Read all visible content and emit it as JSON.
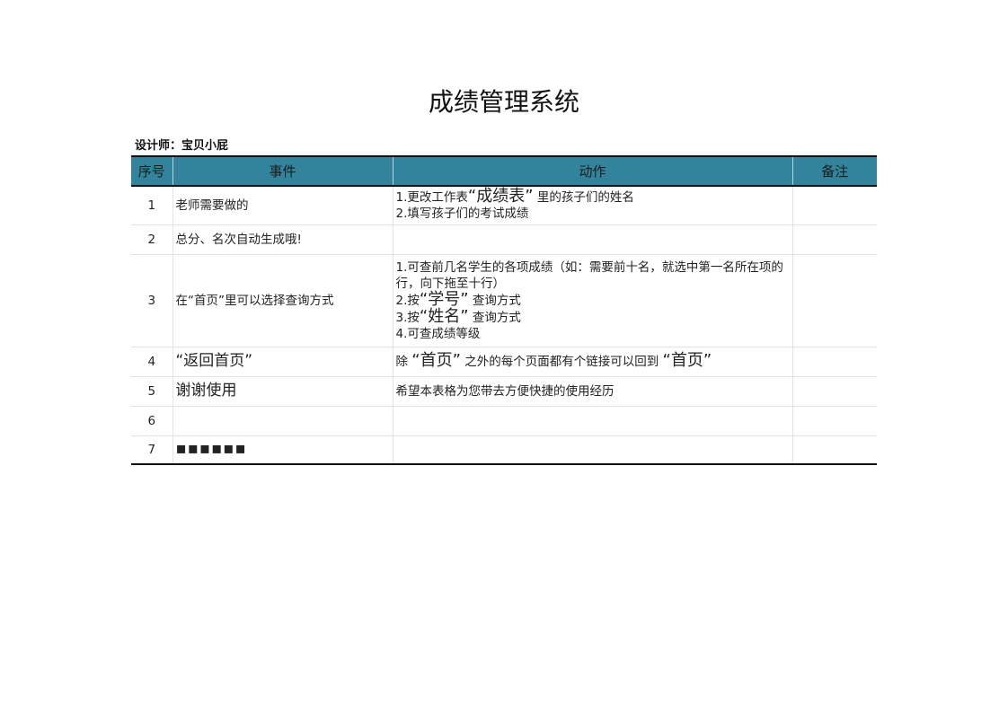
{
  "title": "成绩管理系统",
  "designer": "设计师：宝贝小屁",
  "table": {
    "headers": [
      "序号",
      "事件",
      "动作",
      "备注"
    ],
    "rows": [
      {
        "no": "1",
        "event": "老师需要做的",
        "action": {
          "l1_pre": "1.更改工作表",
          "l1_big": "“成绩表”",
          "l1_post": "里的孩子们的姓名",
          "l2": "2.填写孩子们的考试成绩"
        },
        "note": ""
      },
      {
        "no": "2",
        "event": "总分、名次自动生成哦!",
        "note": ""
      },
      {
        "no": "3",
        "event": "在“首页”里可以选择查询方式",
        "action": {
          "l1": "1.可查前几名学生的各项成绩（如：需要前十名，就选中第一名所在项的行，向下拖至十行）",
          "l2_pre": "2.按",
          "l2_big": "“学号”",
          "l2_post": "查询方式",
          "l3_pre": "3.按",
          "l3_big": "“姓名”",
          "l3_post": "查询方式",
          "l4": "4.可查成绩等级"
        },
        "note": ""
      },
      {
        "no": "4",
        "event": "“返回首页”",
        "action": {
          "pre": "除",
          "big1": "“首页”",
          "mid": "之外的每个页面都有个链接可以回到",
          "big2": "“首页”"
        },
        "note": ""
      },
      {
        "no": "5",
        "event": "谢谢使用",
        "action": "希望本表格为您带去方便快捷的使用经历",
        "note": ""
      },
      {
        "no": "6",
        "event": "",
        "action": "",
        "note": ""
      },
      {
        "no": "7",
        "event": "▪▪▪▪▪▪",
        "action": "",
        "note": ""
      }
    ]
  }
}
